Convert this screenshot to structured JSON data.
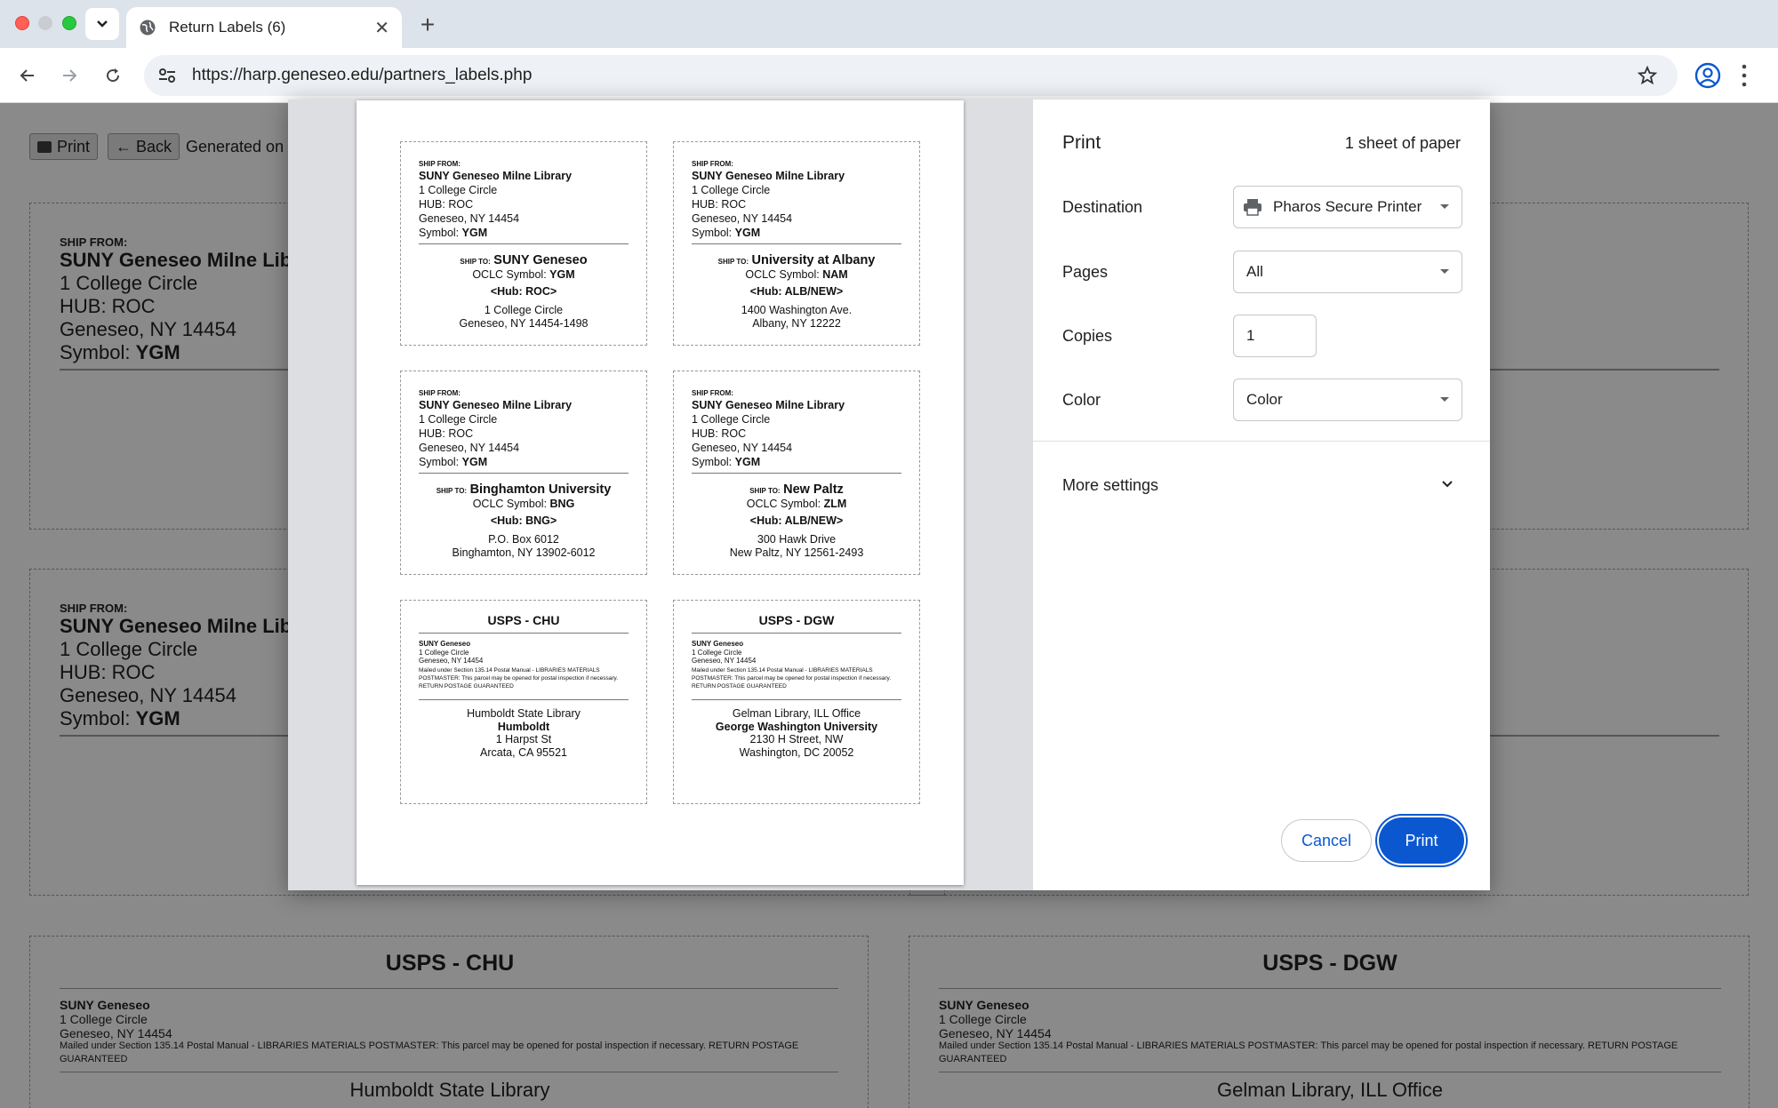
{
  "tab": {
    "title": "Return Labels (6)"
  },
  "address_bar": {
    "url": "https://harp.geneseo.edu/partners_labels.php"
  },
  "page": {
    "print_button": "Print",
    "back_button": "← Back",
    "generated_text": "Generated on",
    "ship_from_heading": "SHIP FROM:",
    "ship_from_name": "SUNY Geneseo Milne Library",
    "ship_from_lines": [
      "1 College Circle",
      "HUB: ROC",
      "Geneseo, NY 14454"
    ],
    "symbol_label": "Symbol:",
    "symbol_value": "YGM",
    "usps_labels": [
      {
        "title": "USPS - CHU",
        "sender_name": "SUNY Geneseo",
        "sender_lines": [
          "1 College Circle",
          "Geneseo, NY 14454"
        ],
        "notice": "Mailed under Section 135.14 Postal Manual - LIBRARIES MATERIALS POSTMASTER: This parcel may be opened for postal inspection if necessary. RETURN POSTAGE GUARANTEED",
        "dest_first_line": "Humboldt State Library"
      },
      {
        "title": "USPS - DGW",
        "sender_name": "SUNY Geneseo",
        "sender_lines": [
          "1 College Circle",
          "Geneseo, NY 14454"
        ],
        "notice": "Mailed under Section 135.14 Postal Manual - LIBRARIES MATERIALS POSTMASTER: This parcel may be opened for postal inspection if necessary. RETURN POSTAGE GUARANTEED",
        "dest_first_line": "Gelman Library, ILL Office"
      }
    ]
  },
  "preview": {
    "ship_from": {
      "heading": "SHIP FROM:",
      "name": "SUNY Geneseo Milne Library",
      "line1": "1 College Circle",
      "line2": "HUB: ROC",
      "line3": "Geneseo, NY 14454",
      "symbol_label": "Symbol:",
      "symbol_value": "YGM"
    },
    "ship_to_labels": [
      {
        "ship_to": "SHIP TO:",
        "name": "SUNY Geneseo",
        "oclc_label": "OCLC Symbol:",
        "oclc": "YGM",
        "hub": "<Hub: ROC>",
        "addr1": "1 College Circle",
        "addr2": "Geneseo, NY 14454-1498"
      },
      {
        "ship_to": "SHIP TO:",
        "name": "University at Albany",
        "oclc_label": "OCLC Symbol:",
        "oclc": "NAM",
        "hub": "<Hub: ALB/NEW>",
        "addr1": "1400 Washington Ave.",
        "addr2": "Albany, NY 12222"
      },
      {
        "ship_to": "SHIP TO:",
        "name": "Binghamton University",
        "oclc_label": "OCLC Symbol:",
        "oclc": "BNG",
        "hub": "<Hub: BNG>",
        "addr1": "P.O. Box 6012",
        "addr2": "Binghamton, NY 13902-6012"
      },
      {
        "ship_to": "SHIP TO:",
        "name": "New Paltz",
        "oclc_label": "OCLC Symbol:",
        "oclc": "ZLM",
        "hub": "<Hub: ALB/NEW>",
        "addr1": "300 Hawk Drive",
        "addr2": "New Paltz, NY 12561-2493"
      }
    ],
    "usps_labels": [
      {
        "title": "USPS - CHU",
        "sender_name": "SUNY Geneseo",
        "sender1": "1 College Circle",
        "sender2": "Geneseo, NY 14454",
        "notice": "Mailed under Section 135.14 Postal Manual - LIBRARIES MATERIALS POSTMASTER: This parcel may be opened for postal inspection if necessary. RETURN POSTAGE GUARANTEED",
        "dest1": "Humboldt State Library",
        "dest2": "Humboldt",
        "dest3": "1 Harpst St",
        "dest4": "Arcata, CA 95521"
      },
      {
        "title": "USPS - DGW",
        "sender_name": "SUNY Geneseo",
        "sender1": "1 College Circle",
        "sender2": "Geneseo, NY 14454",
        "notice": "Mailed under Section 135.14 Postal Manual - LIBRARIES MATERIALS POSTMASTER: This parcel may be opened for postal inspection if necessary. RETURN POSTAGE GUARANTEED",
        "dest1": "Gelman Library, ILL Office",
        "dest2": "George Washington University",
        "dest3": "2130 H Street, NW",
        "dest4": "Washington, DC 20052"
      }
    ]
  },
  "print_dialog": {
    "title": "Print",
    "sheets": "1 sheet of paper",
    "destination_label": "Destination",
    "destination_value": "Pharos Secure Printer",
    "pages_label": "Pages",
    "pages_value": "All",
    "copies_label": "Copies",
    "copies_value": "1",
    "color_label": "Color",
    "color_value": "Color",
    "more_settings": "More settings",
    "cancel": "Cancel",
    "print": "Print"
  },
  "colors": {
    "accent": "#0b57d0",
    "tabbar": "#dde3ea",
    "overlay": "#8a8a8a"
  },
  "icons": [
    "chevron-down-icon",
    "globe-icon",
    "close-icon",
    "plus-icon",
    "back-arrow-icon",
    "forward-arrow-icon",
    "reload-icon",
    "site-settings-icon",
    "star-icon",
    "profile-icon",
    "kebab-menu-icon",
    "printer-icon"
  ]
}
